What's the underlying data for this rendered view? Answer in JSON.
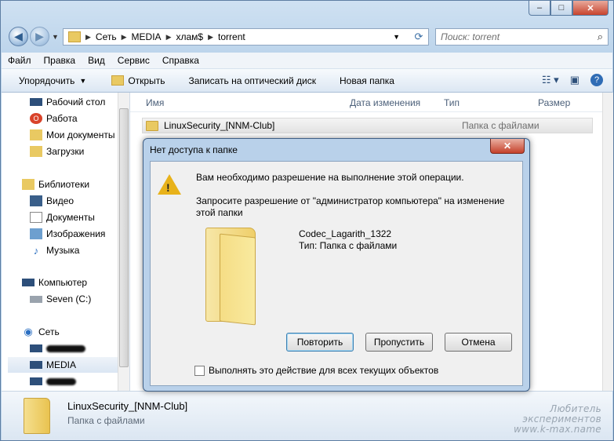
{
  "window": {
    "min": "–",
    "max": "□",
    "close": "✕"
  },
  "address": {
    "crumbs": [
      "Сеть",
      "MEDIA",
      "хлам$",
      "torrent"
    ]
  },
  "search": {
    "placeholder": "Поиск: torrent"
  },
  "menu": [
    "Файл",
    "Правка",
    "Вид",
    "Сервис",
    "Справка"
  ],
  "toolbar": {
    "organize": "Упорядочить",
    "open": "Открыть",
    "burn": "Записать на оптический диск",
    "new_folder": "Новая папка"
  },
  "nav": {
    "desktop": "Рабочий стол",
    "work": "Работа",
    "mydocs": "Мои документы",
    "downloads": "Загрузки",
    "libraries": "Библиотеки",
    "video": "Видео",
    "documents": "Документы",
    "images": "Изображения",
    "music": "Музыка",
    "computer": "Компьютер",
    "drive_c": "Seven (C:)",
    "network": "Сеть",
    "media": "MEDIA"
  },
  "columns": {
    "name": "Имя",
    "date": "Дата изменения",
    "type": "Тип",
    "size": "Размер"
  },
  "files": [
    {
      "name": "LinuxSecurity_[NNM-Club]",
      "type": "Папка с файлами"
    }
  ],
  "details": {
    "name": "LinuxSecurity_[NNM-Club]",
    "type": "Папка с файлами"
  },
  "watermark": {
    "line1": "Любитель",
    "line2": "экспериментов",
    "line3": "www.k-max.name"
  },
  "dialog": {
    "title": "Нет доступа к папке",
    "close": "✕",
    "msg1": "Вам необходимо разрешение на выполнение этой операции.",
    "msg2": "Запросите разрешение от \"администратор компьютера\" на изменение этой папки",
    "folder_name": "Codec_Lagarith_1322",
    "folder_type": "Тип: Папка с файлами",
    "retry": "Повторить",
    "skip": "Пропустить",
    "cancel": "Отмена",
    "apply_all": "Выполнять это действие для всех текущих объектов"
  }
}
